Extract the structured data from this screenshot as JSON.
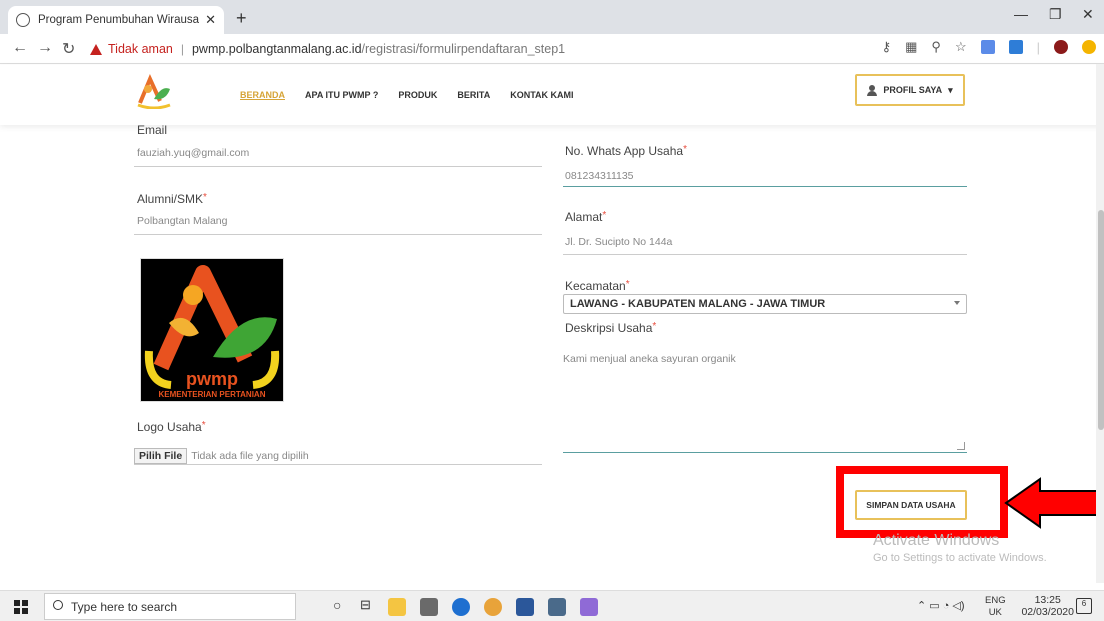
{
  "browser": {
    "tab_title": "Program Penumbuhan Wirausaha",
    "insecure_label": "Tidak aman",
    "url_host": "pwmp.polbangtanmalang.ac.id",
    "url_path": "/registrasi/formulirpendaftaran_step1"
  },
  "navbar": {
    "links": [
      "BERANDA",
      "APA ITU PWMP ?",
      "PRODUK",
      "BERITA",
      "KONTAK KAMI"
    ],
    "profile_label": "PROFIL SAYA"
  },
  "form": {
    "email_label": "Email",
    "email_value": "fauziah.yuq@gmail.com",
    "alumni_label": "Alumni/SMK",
    "alumni_value": "Polbangtan Malang",
    "logo_label": "Logo Usaha",
    "file_button": "Pilih File",
    "file_status": "Tidak ada file yang dipilih",
    "whatsapp_label": "No. Whats App Usaha",
    "whatsapp_value": "081234311135",
    "alamat_label": "Alamat",
    "alamat_value": "Jl. Dr. Sucipto No 144a",
    "kecamatan_label": "Kecamatan",
    "kecamatan_value": "LAWANG - KABUPATEN MALANG - JAWA TIMUR",
    "deskripsi_label": "Deskripsi Usaha",
    "deskripsi_value": "Kami menjual aneka sayuran organik",
    "required_mark": "*",
    "save_button": "SIMPAN DATA USAHA"
  },
  "logo_image": {
    "text_top": "pwmp",
    "text_bottom": "KEMENTERIAN PERTANIAN"
  },
  "watermark": {
    "line1": "Activate Windows",
    "line2": "Go to Settings to activate Windows."
  },
  "taskbar": {
    "search_placeholder": "Type here to search",
    "lang_1": "ENG",
    "lang_2": "UK",
    "time": "13:25",
    "date": "02/03/2020",
    "notif_count": "6"
  },
  "colors": {
    "accent_gold": "#e8c15a",
    "highlight_red": "#ff0000",
    "insecure_red": "#c5221f"
  }
}
